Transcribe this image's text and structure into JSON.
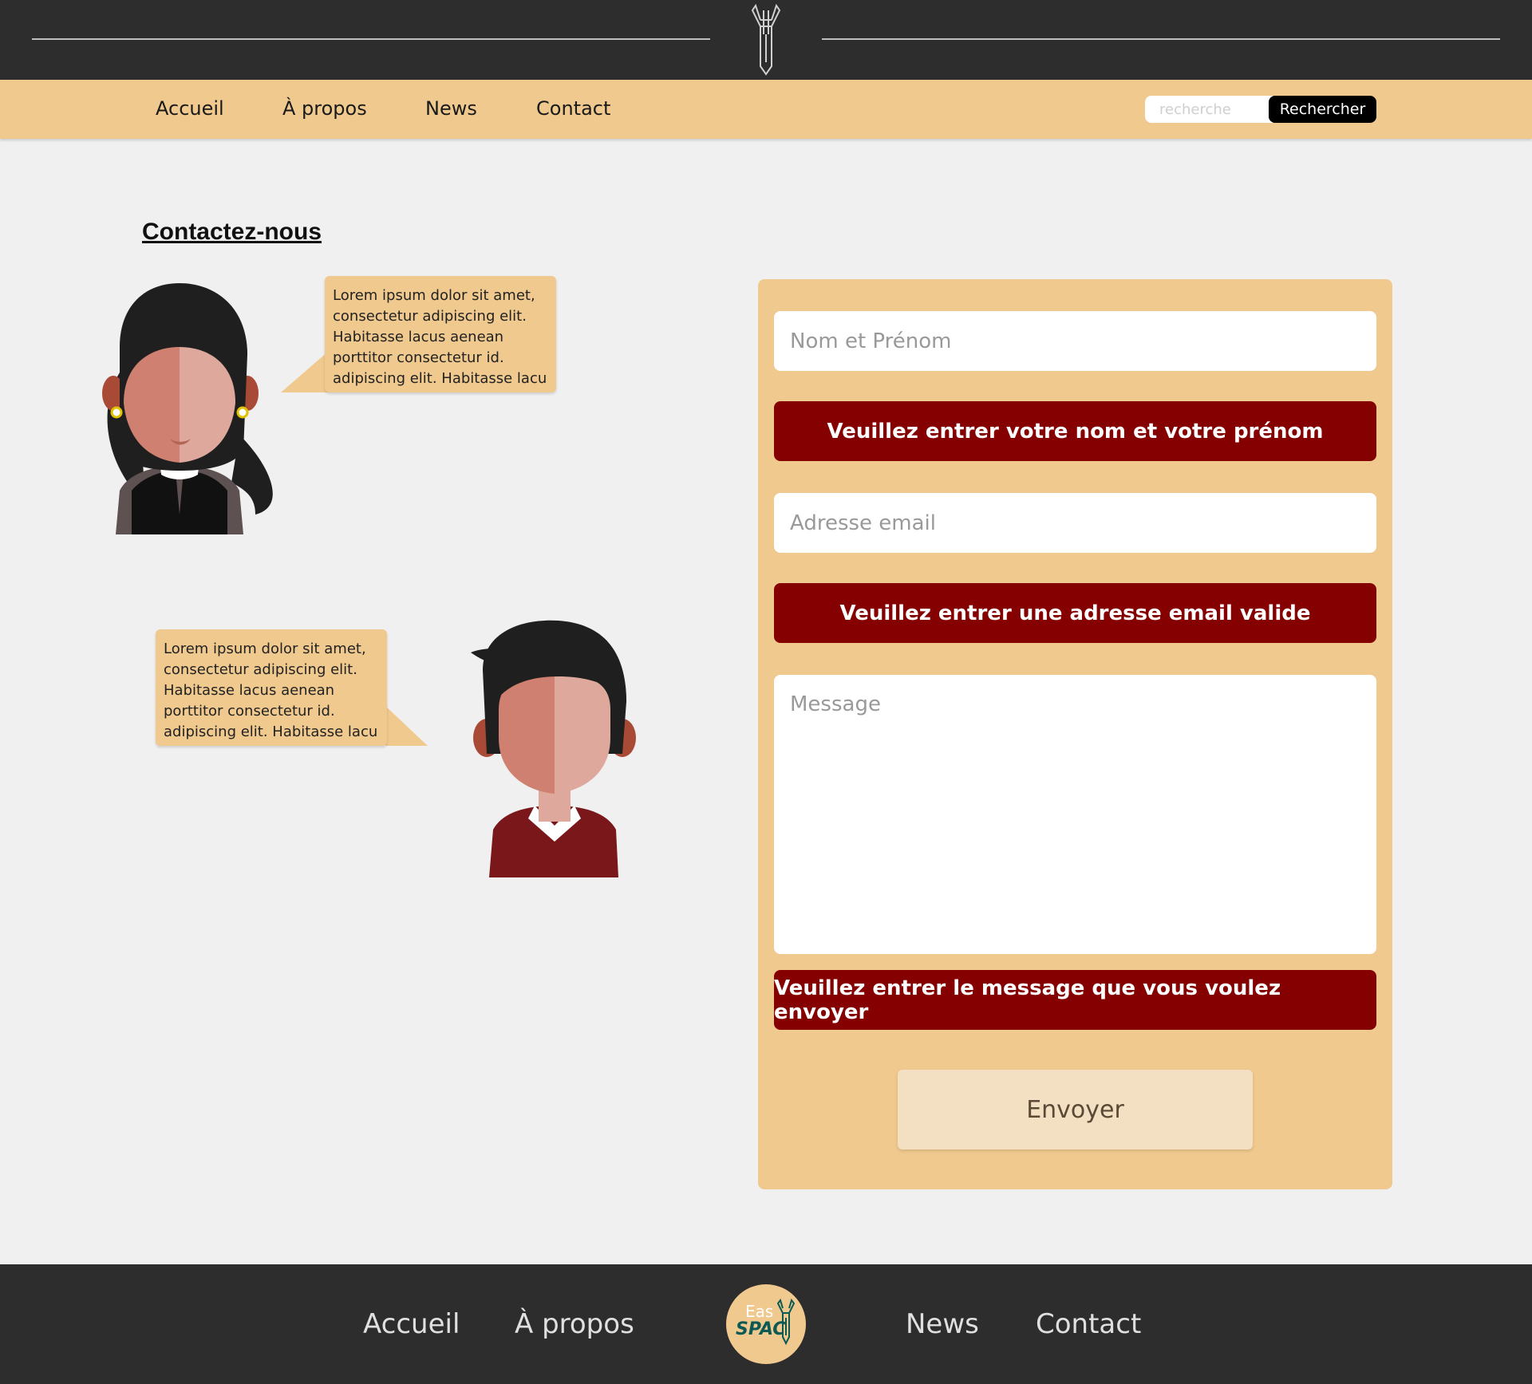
{
  "nav": {
    "items": [
      "Accueil",
      "À propos",
      "News",
      "Contact"
    ]
  },
  "search": {
    "placeholder": "recherche",
    "button_label": "Rechercher"
  },
  "page": {
    "title": "Contactez-nous"
  },
  "bubbles": [
    {
      "text": "Lorem ipsum dolor sit amet, consectetur adipiscing elit. Habitasse lacus aenean porttitor consectetur id. adipiscing elit. Habitasse lacu"
    },
    {
      "text": "Lorem ipsum dolor sit amet, consectetur adipiscing elit. Habitasse lacus aenean porttitor consectetur id. adipiscing elit. Habitasse lacu"
    }
  ],
  "form": {
    "name_placeholder": "Nom et Prénom",
    "name_error": "Veuillez entrer votre nom et votre prénom",
    "email_placeholder": "Adresse email",
    "email_error": "Veuillez entrer une adresse email valide",
    "message_placeholder": "Message",
    "message_error": "Veuillez entrer le message que vous voulez envoyer",
    "submit_label": "Envoyer"
  },
  "footer": {
    "items": [
      "Accueil",
      "À propos",
      "News",
      "Contact"
    ],
    "logo_text_1": "Eas",
    "logo_text_2": "SPAC"
  },
  "colors": {
    "nav_bg": "#f0c98e",
    "dark_bg": "#2d2d2d",
    "error_bg": "#850000",
    "page_bg": "#f0f0f0"
  },
  "icons": {
    "header_logo": "rocket-icon",
    "footer_logo": "rocket-badge-icon"
  }
}
